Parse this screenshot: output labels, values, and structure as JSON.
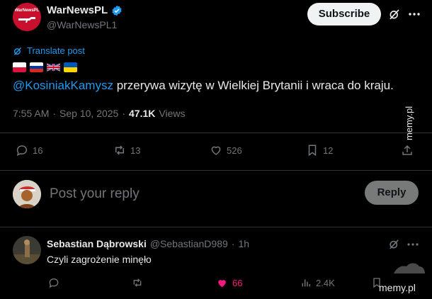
{
  "colors": {
    "accent": "#1d9bf0",
    "like": "#f91880",
    "muted": "#71767b",
    "divider": "#2f3336"
  },
  "post": {
    "author_name": "WarNewsPL",
    "handle": "@WarNewsPL1",
    "avatar_text": "WarNewsPL",
    "subscribe_label": "Subscribe",
    "translate_label": "Translate post",
    "mention": "@KosiniakKamysz",
    "body_rest": " przerywa wizytę w Wielkiej Brytanii i wraca do kraju.",
    "time": "7:55 AM",
    "dot1": "·",
    "date": "Sep 10, 2025",
    "dot2": "·",
    "views_count": "47.1K",
    "views_label": "Views",
    "actions": {
      "replies": "16",
      "reposts": "13",
      "likes": "526",
      "bookmarks": "12"
    }
  },
  "composer": {
    "placeholder": "Post your reply",
    "reply_label": "Reply"
  },
  "reply": {
    "author_name": "Sebastian Dąbrowski",
    "handle": "@SebastianD989",
    "dot": "·",
    "age": "1h",
    "text": "Czyli zagrożenie minęło",
    "actions": {
      "likes": "66",
      "views": "2.4K"
    }
  },
  "watermark": {
    "side": "memy.pl",
    "corner": "memy.pl"
  }
}
